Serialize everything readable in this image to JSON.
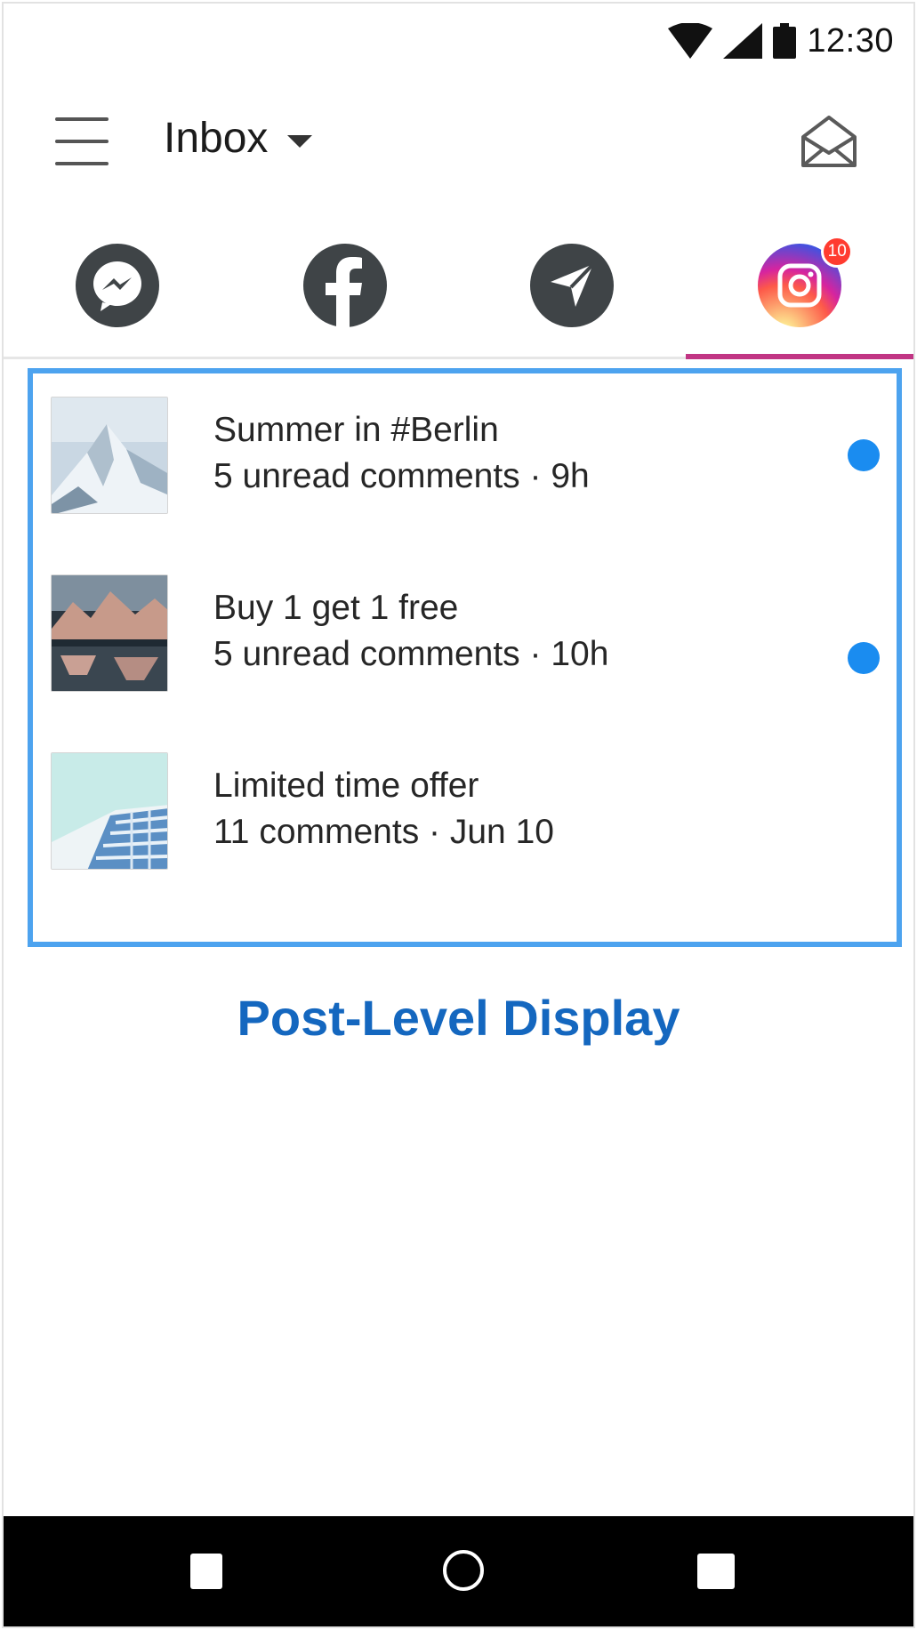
{
  "status_bar": {
    "time": "12:30",
    "icons": [
      "wifi-icon",
      "signal-icon",
      "battery-icon"
    ]
  },
  "app_bar": {
    "title": "Inbox",
    "menu_icon": "hamburger-menu-icon",
    "compose_icon": "open-envelope-icon"
  },
  "tabs": [
    {
      "icon": "messenger-icon",
      "active": false
    },
    {
      "icon": "facebook-icon",
      "active": false
    },
    {
      "icon": "send-icon",
      "active": false
    },
    {
      "icon": "instagram-icon",
      "active": true,
      "badge": "10"
    }
  ],
  "posts": [
    {
      "title": "Summer in #Berlin",
      "subtitle": "5 unread comments · 9h",
      "unread": true
    },
    {
      "title": "Buy 1 get 1 free",
      "subtitle": "5 unread comments · 10h",
      "unread": true
    },
    {
      "title": "Limited time offer",
      "subtitle": "11 comments · Jun 10",
      "unread": false
    }
  ],
  "caption": "Post-Level Display",
  "colors": {
    "highlight_border": "#4da3ef",
    "caption": "#1467bf",
    "unread_dot": "#1a8cf0",
    "active_tab_indicator": "#c13584",
    "badge": "#ff3b30"
  }
}
